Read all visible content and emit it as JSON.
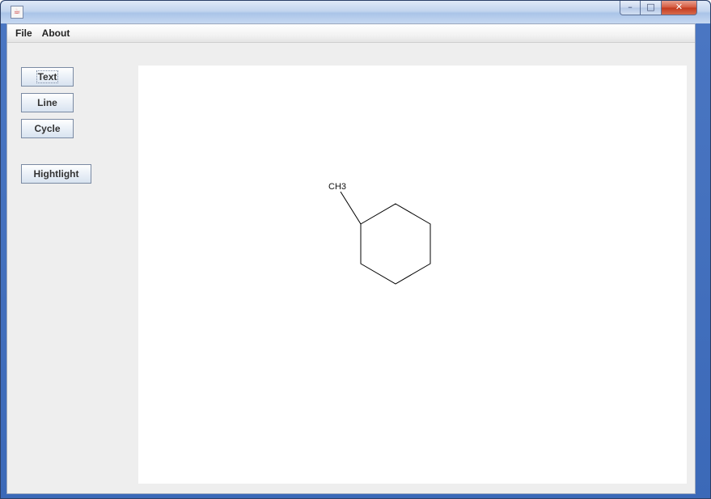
{
  "window": {
    "title": "",
    "controls": {
      "minimize_glyph": "–",
      "maximize_glyph": "□",
      "close_glyph": "✕"
    }
  },
  "menubar": {
    "items": [
      {
        "label": "File"
      },
      {
        "label": "About"
      }
    ]
  },
  "toolbar": {
    "text_label": "Text",
    "line_label": "Line",
    "cycle_label": "Cycle",
    "highlight_label": "Hightlight"
  },
  "canvas": {
    "background": "#ffffff",
    "molecule": {
      "substituent_label": "CH3"
    }
  },
  "colors": {
    "client_background": "#eeeeee",
    "titlebar_accent": "#4a76c2",
    "drawing_stroke": "#000000"
  },
  "icons": {
    "app_icon": "java-cup-icon"
  }
}
